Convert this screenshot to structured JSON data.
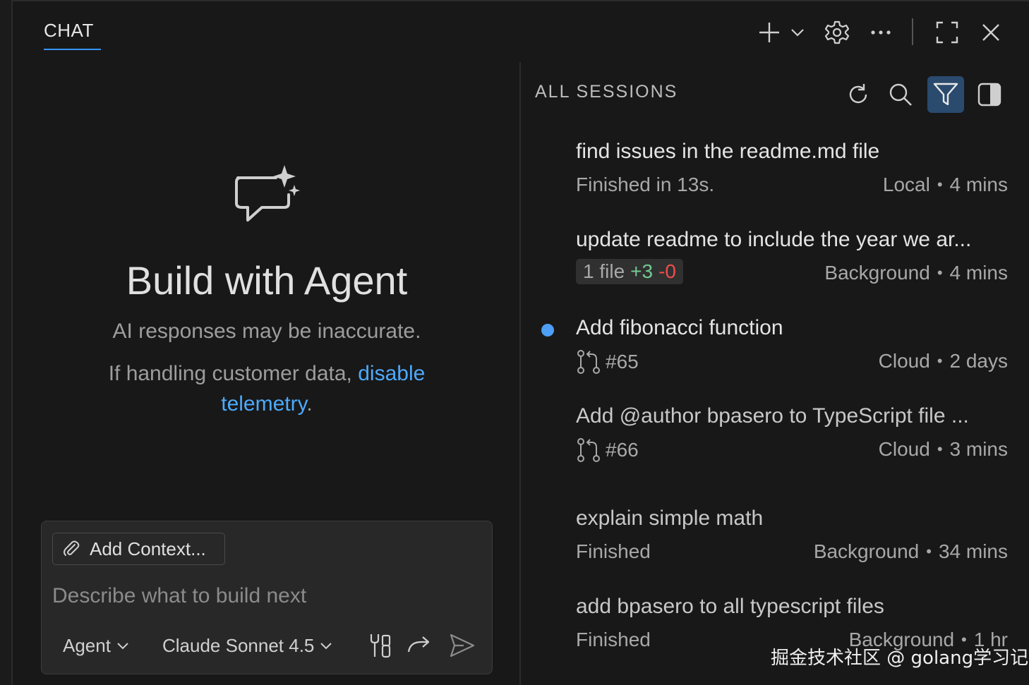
{
  "header": {
    "tab_label": "CHAT"
  },
  "welcome": {
    "title": "Build with Agent",
    "subtitle": "AI responses may be inaccurate.",
    "note_prefix": "If handling customer data, ",
    "note_link": "disable telemetry",
    "note_suffix": "."
  },
  "input": {
    "add_context_label": "Add Context...",
    "placeholder": "Describe what to build next",
    "mode_label": "Agent",
    "model_label": "Claude Sonnet 4.5"
  },
  "sessions": {
    "header": "ALL SESSIONS",
    "items": [
      {
        "title": "find issues in the readme.md file",
        "status": "Finished in 13s.",
        "location": "Local",
        "age": "4 mins"
      },
      {
        "title": "update readme to include the year we ar...",
        "diff_files": "1 file",
        "diff_add": "+3",
        "diff_del": "-0",
        "location": "Background",
        "age": "4 mins"
      },
      {
        "title": "Add fibonacci function",
        "pr": "#65",
        "location": "Cloud",
        "age": "2 days"
      },
      {
        "title": "Add @author bpasero to TypeScript file ...",
        "pr": "#66",
        "location": "Cloud",
        "age": "3 mins"
      },
      {
        "title": "explain simple math",
        "status": "Finished",
        "location": "Background",
        "age": "34 mins"
      },
      {
        "title": "add bpasero to all typescript files",
        "status": "Finished",
        "location": "Background",
        "age": "1 hr"
      }
    ]
  },
  "watermark": "掘金技术社区 @ golang学习记",
  "colors": {
    "accent": "#3794ff",
    "link": "#4daafc",
    "unread": "#4d9ef5",
    "add": "#73c991",
    "delete": "#f14c4c"
  },
  "icons": [
    "plus-icon",
    "chevron-down-icon",
    "gear-icon",
    "ellipsis-icon",
    "maximize-icon",
    "close-icon",
    "chat-sparkle-icon",
    "paperclip-icon",
    "tools-icon",
    "redirect-icon",
    "send-icon",
    "refresh-icon",
    "search-icon",
    "filter-icon",
    "panel-toggle-icon",
    "pull-request-icon"
  ]
}
